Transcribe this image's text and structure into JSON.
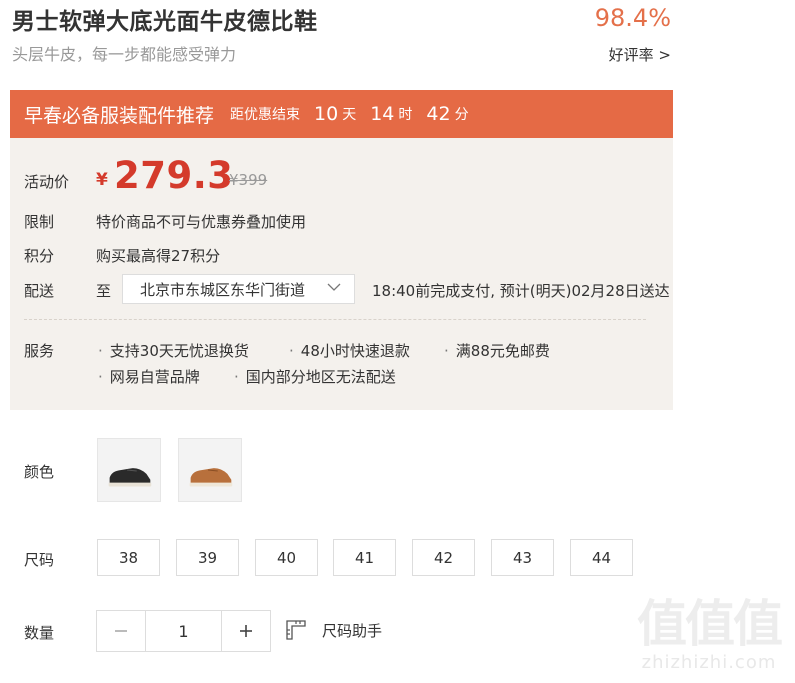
{
  "product": {
    "title": "男士软弹大底光面牛皮德比鞋",
    "subtitle": "头层牛皮，每一步都能感受弹力",
    "rating": "98.4%",
    "rating_label": "好评率 >"
  },
  "promo": {
    "title": "早春必备服装配件推荐",
    "countdown_label": "距优惠结束",
    "days": "10",
    "days_unit": "天",
    "hours": "14",
    "hours_unit": "时",
    "minutes": "42",
    "minutes_unit": "分"
  },
  "price": {
    "label": "活动价",
    "currency": "¥",
    "current": "279.3",
    "original": "¥399"
  },
  "limit": {
    "label": "限制",
    "text": "特价商品不可与优惠券叠加使用"
  },
  "points": {
    "label": "积分",
    "text": "购买最高得27积分"
  },
  "delivery": {
    "label": "配送",
    "to": "至",
    "address": "北京市东城区东华门街道",
    "eta": "18:40前完成支付, 预计(明天)02月28日送达"
  },
  "services": {
    "label": "服务",
    "items": [
      "支持30天无忧退换货",
      "48小时快速退款",
      "满88元免邮费",
      "网易自营品牌",
      "国内部分地区无法配送"
    ]
  },
  "color": {
    "label": "颜色",
    "options": [
      "black-shoe",
      "brown-shoe"
    ]
  },
  "size": {
    "label": "尺码",
    "options": [
      "38",
      "39",
      "40",
      "41",
      "42",
      "43",
      "44"
    ]
  },
  "quantity": {
    "label": "数量",
    "value": "1",
    "minus": "−",
    "plus": "+"
  },
  "size_helper": {
    "label": "尺码助手"
  },
  "watermark": {
    "logo": "值值值",
    "url": "zhizhizhi.com"
  },
  "colors": {
    "accent": "#e56a45",
    "price_red": "#d43a2b",
    "panel_bg": "#f4f1ed",
    "rating": "#e4704a"
  }
}
